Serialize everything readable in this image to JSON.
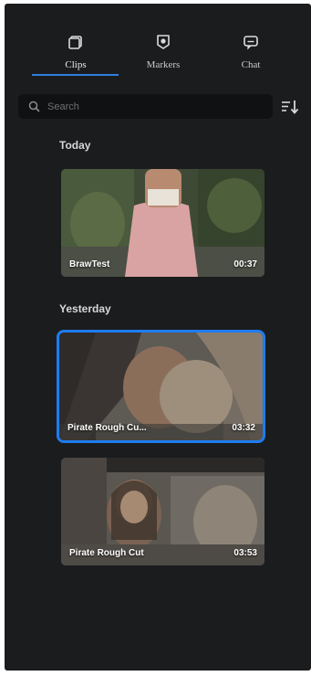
{
  "tabs": [
    {
      "label": "Clips",
      "icon": "clips-icon",
      "active": true
    },
    {
      "label": "Markers",
      "icon": "markers-icon",
      "active": false
    },
    {
      "label": "Chat",
      "icon": "chat-icon",
      "active": false
    }
  ],
  "search": {
    "placeholder": "Search",
    "value": ""
  },
  "sort": {
    "icon": "sort-icon"
  },
  "sections": [
    {
      "title": "Today",
      "clips": [
        {
          "title": "BrawTest",
          "duration": "00:37",
          "selected": false
        }
      ]
    },
    {
      "title": "Yesterday",
      "clips": [
        {
          "title": "Pirate Rough Cu...",
          "duration": "03:32",
          "selected": true
        },
        {
          "title": "Pirate Rough Cut",
          "duration": "03:53",
          "selected": false
        }
      ]
    }
  ],
  "colors": {
    "panel_bg": "#1b1c1e",
    "accent": "#1f7cf0",
    "text": "#d6d7d9"
  }
}
